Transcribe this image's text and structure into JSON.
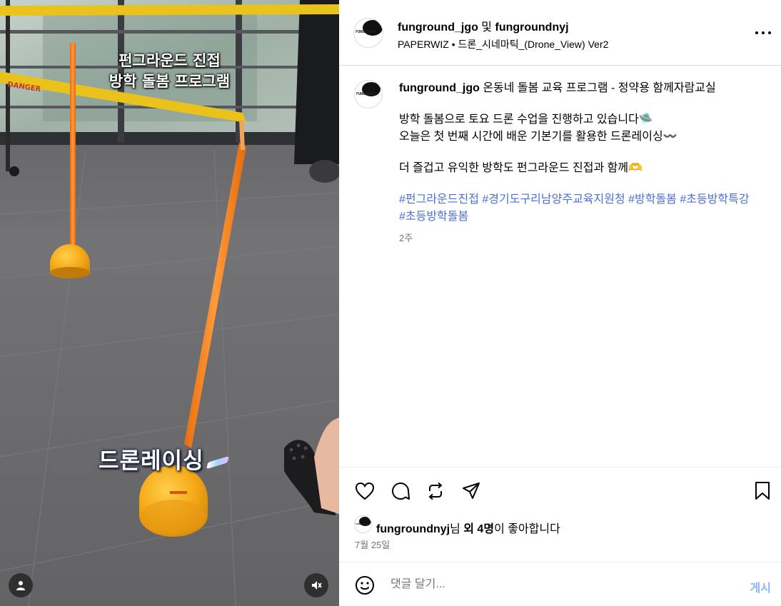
{
  "media": {
    "overlay_line1": "펀그라운드 진접",
    "overlay_line2": "방학 돌봄 프로그램",
    "overlay_race": "드론레이싱",
    "tape_text": "DANGER",
    "user_tag_icon": "person-icon",
    "mute_icon": "speaker-muted-icon"
  },
  "header": {
    "author1": "funground_jgo",
    "connector": " 및 ",
    "author2": "fungroundnyj",
    "audio_artist": "PAPERWIZ",
    "audio_separator": " • ",
    "audio_track": "드론_시네마틱_(Drone_View) Ver2",
    "avatar_logo_text": "FUNGROUND"
  },
  "caption": {
    "username": "funground_jgo",
    "headline": "온동네 돌봄 교육 프로그램 - 정약용 함께자람교실",
    "line1": "방학 돌봄으로 토요 드론 수업을 진행하고 있습니다🛸",
    "line2": "오늘은 첫 번째 시간에 배운 기본기를 활용한 드론레이싱〰️",
    "line3": "더 즐겁고 유익한 방학도 펀그라운드 진접과 함께🫶",
    "hashtags": [
      "#펀그라운드진접",
      "#경기도구리남양주교육지원청",
      "#방학돌봄",
      "#초등방학특강",
      "#초등방학돌봄"
    ],
    "time_ago": "2주"
  },
  "actions": {
    "like_icon": "heart-icon",
    "comment_icon": "comment-icon",
    "repost_icon": "repost-icon",
    "share_icon": "send-icon",
    "save_icon": "bookmark-icon"
  },
  "likes": {
    "user": "fungroundnyj",
    "suffix1": "님 ",
    "others": "외 4명",
    "suffix2": "이 좋아합니다"
  },
  "date": "7월 25일",
  "comment": {
    "placeholder": "댓글 달기...",
    "post_label": "게시",
    "emoji_icon": "smiley-icon"
  },
  "colors": {
    "link": "#4b6fd6",
    "muted": "#737373",
    "orange": "#f28a1e",
    "post_disabled": "#8ab4f8"
  }
}
